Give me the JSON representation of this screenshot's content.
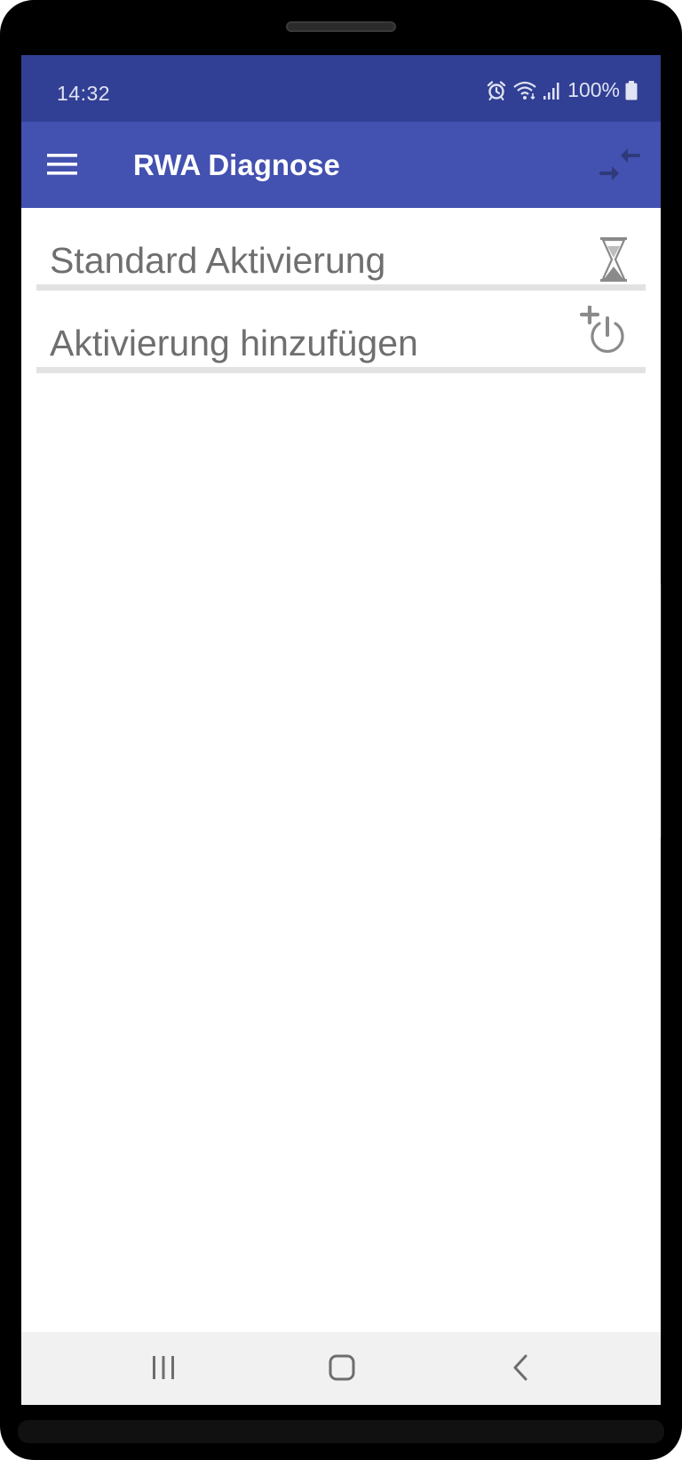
{
  "status_bar": {
    "time": "14:32",
    "battery_percent": "100%",
    "icons": [
      "alarm-icon",
      "wifi-icon",
      "signal-icon",
      "battery-icon"
    ]
  },
  "app_bar": {
    "title": "RWA Diagnose",
    "menu_icon": "hamburger-menu-icon",
    "action_icon": "collapse-arrows-icon"
  },
  "list": {
    "items": [
      {
        "label": "Standard Aktivierung",
        "icon": "hourglass-icon"
      },
      {
        "label": "Aktivierung hinzufügen",
        "icon": "add-power-icon"
      }
    ]
  },
  "nav_bar": {
    "buttons": [
      "recent-apps-icon",
      "home-icon",
      "back-icon"
    ]
  },
  "colors": {
    "status_bar": "#313F94",
    "app_bar": "#4351B0",
    "list_text": "#6F6F6F",
    "divider": "#E2E2E2",
    "nav_bar": "#F1F1F1"
  }
}
